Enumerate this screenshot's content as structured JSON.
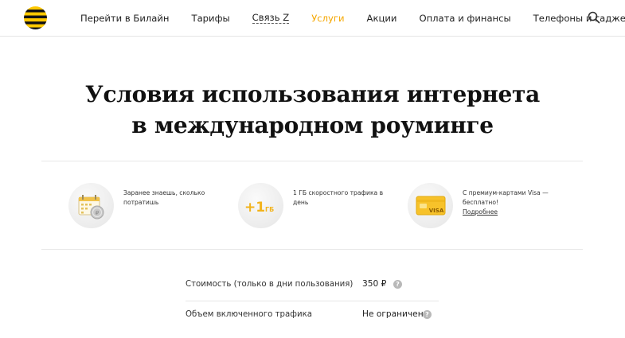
{
  "header": {
    "logo_icon": "beeline-logo-icon",
    "nav": [
      {
        "label": "Перейти в Билайн",
        "style": "normal"
      },
      {
        "label": "Тарифы",
        "style": "normal"
      },
      {
        "label": "Связь Z",
        "style": "dotted"
      },
      {
        "label": "Услуги",
        "style": "active"
      },
      {
        "label": "Акции",
        "style": "normal"
      },
      {
        "label": "Оплата и финансы",
        "style": "normal"
      },
      {
        "label": "Телефоны и гаджеты",
        "style": "normal"
      }
    ],
    "search_icon": "search-icon"
  },
  "title": {
    "line1": "Условия использования интернета",
    "line2": "в международном роуминге"
  },
  "features": [
    {
      "icon": "calendar-coin-icon",
      "text": "Заранее знаешь, сколько потратишь",
      "link": ""
    },
    {
      "icon": "plus-1gb-icon",
      "badge": "+1",
      "badge_unit": "ГБ",
      "text": "1 ГБ скоростного трафика в день",
      "link": ""
    },
    {
      "icon": "visa-card-icon",
      "badge": "VISA",
      "text": "С премиум-картами Visa — бесплатно!",
      "link": "Подробнее"
    }
  ],
  "table": [
    {
      "label": "Стоимость (только в дни пользования)",
      "value": "350 ₽"
    },
    {
      "label": "Объем включенного трафика",
      "value": "Не ограничен"
    }
  ],
  "colors": {
    "accent": "#f5a700",
    "brand_yellow": "#ffc800",
    "help_gray": "#b9b9b9"
  }
}
